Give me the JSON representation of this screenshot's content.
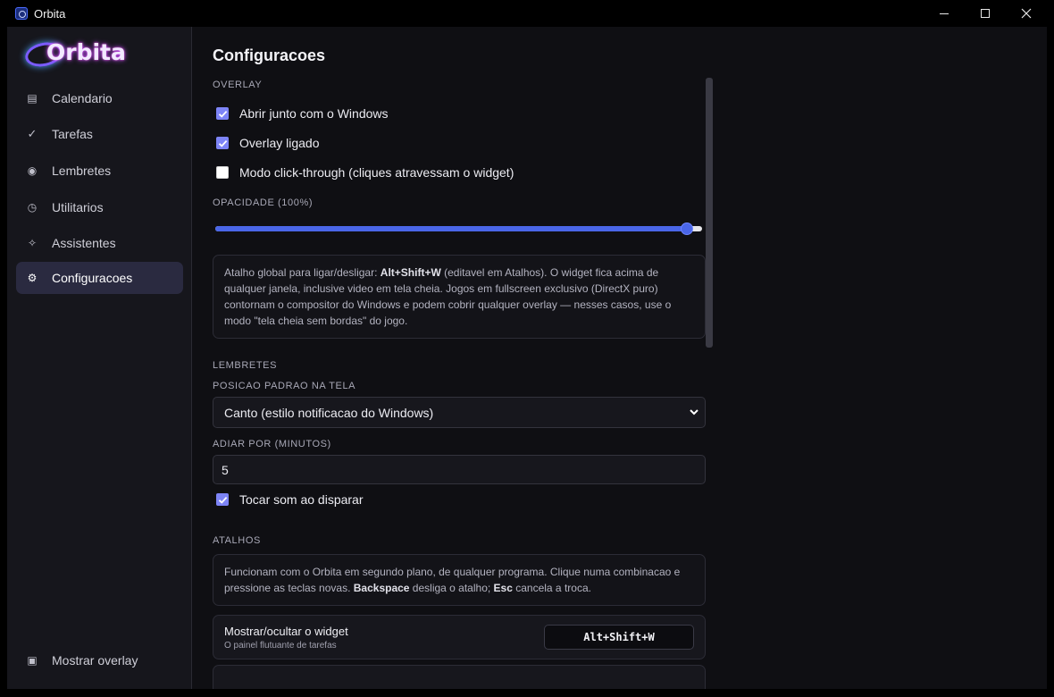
{
  "window": {
    "title": "Orbita"
  },
  "sidebar": {
    "logo_text": "Orbita",
    "items": [
      {
        "label": "Calendario",
        "icon": "list-icon"
      },
      {
        "label": "Tarefas",
        "icon": "check-icon"
      },
      {
        "label": "Lembretes",
        "icon": "dot-icon"
      },
      {
        "label": "Utilitarios",
        "icon": "clock-icon"
      },
      {
        "label": "Assistentes",
        "icon": "sparkle-icon"
      },
      {
        "label": "Configuracoes",
        "icon": "gear-icon",
        "active": true
      }
    ],
    "footer_item": {
      "label": "Mostrar overlay",
      "icon": "square-icon"
    }
  },
  "main": {
    "title": "Configuracoes",
    "overlay": {
      "section_label": "OVERLAY",
      "options": [
        {
          "label": "Abrir junto com o Windows",
          "checked": true
        },
        {
          "label": "Overlay ligado",
          "checked": true
        },
        {
          "label": "Modo click-through (cliques atravessam o widget)",
          "checked": false
        }
      ],
      "opacity_label": "OPACIDADE (100%)",
      "opacity_value": 1.0,
      "info": {
        "p1": "Atalho global para ligar/desligar: ",
        "key": "Alt+Shift+W",
        "p2": " (editavel em Atalhos). O widget fica acima de qualquer janela, inclusive video em tela cheia. Jogos em fullscreen exclusivo (DirectX puro) contornam o compositor do Windows e podem cobrir qualquer overlay — nesses casos, use o modo \"tela cheia sem bordas\" do jogo."
      }
    },
    "reminders": {
      "section_label": "LEMBRETES",
      "position_label": "POSICAO PADRAO NA TELA",
      "position_value": "Canto (estilo notificacao do Windows)",
      "snooze_label": "ADIAR POR (MINUTOS)",
      "snooze_value": "5",
      "sound_label": "Tocar som ao disparar",
      "sound_checked": true
    },
    "shortcuts": {
      "section_label": "ATALHOS",
      "info": {
        "p1": "Funcionam com o Orbita em segundo plano, de qualquer programa. Clique numa combinacao e pressione as teclas novas. ",
        "k1": "Backspace",
        "p2": " desliga o atalho; ",
        "k2": "Esc",
        "p3": " cancela a troca."
      },
      "items": [
        {
          "title": "Mostrar/ocultar o widget",
          "subtitle": "O painel flutuante de tarefas",
          "keys": "Alt+Shift+W"
        }
      ]
    }
  },
  "colors": {
    "accent": "#4a66e8",
    "checkbox": "#7d84f6",
    "active_nav": "#2a2a40",
    "background": "#0f0f13"
  }
}
